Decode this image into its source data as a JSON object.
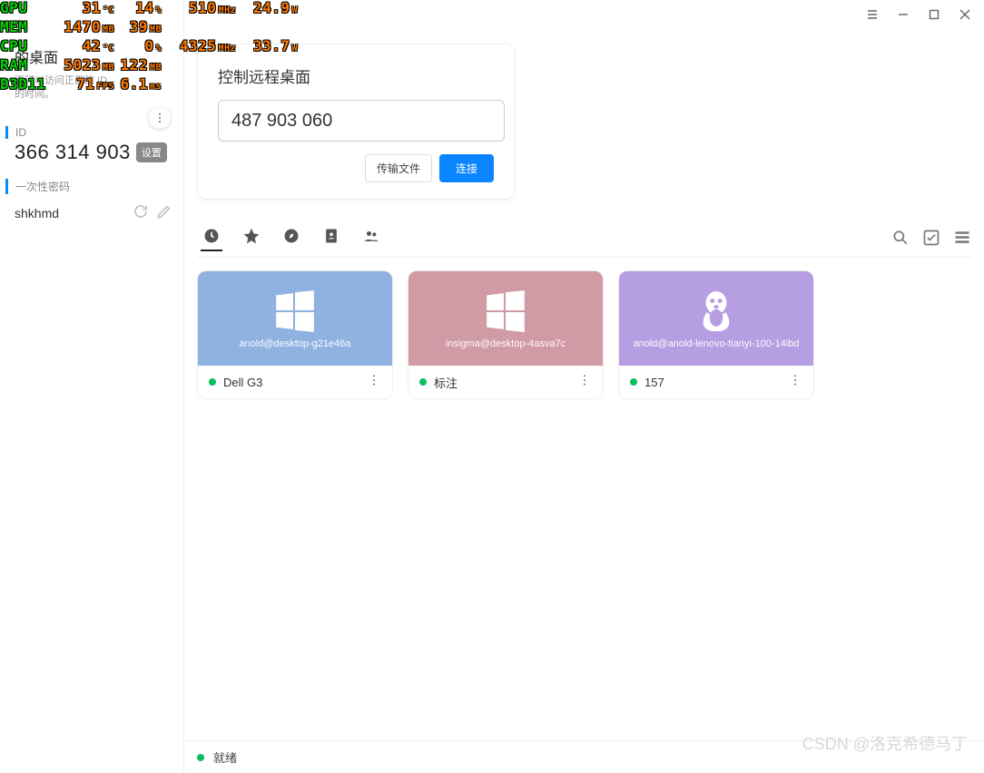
{
  "overlay": {
    "rows": [
      "GPU",
      "MEM",
      "CPU",
      "RAM",
      "D3D11"
    ],
    "gpu": {
      "temp": "31",
      "temp_u": "°C",
      "load": "14",
      "load_u": "%",
      "clk": "510",
      "clk_u": "MHz",
      "pw": "24.9",
      "pw_u": "W"
    },
    "mem": {
      "v1": "1470",
      "v1_u": "MB",
      "v2": "39",
      "v2_u": "MB"
    },
    "cpu": {
      "temp": "42",
      "temp_u": "°C",
      "load": "0",
      "load_u": "%",
      "clk": "4325",
      "clk_u": "MHz",
      "pw": "33.7",
      "pw_u": "W"
    },
    "ram": {
      "v1": "5023",
      "v1_u": "MB",
      "v2": "122",
      "v2_u": "MB"
    },
    "d3d": {
      "v1": "71",
      "v1_u": "FPS",
      "v2": "6.1",
      "v2_u": "ms"
    }
  },
  "sidebar": {
    "title": "的桌面",
    "sub": "面可以访问正面的 ID",
    "sub2": "的时间。",
    "id_label": "ID",
    "id_value": "366 314 903",
    "id_set": "设置",
    "pw_label": "一次性密码",
    "pw_value": "shkhmd"
  },
  "control": {
    "title": "控制远程桌面",
    "input": "487 903 060",
    "btn_file": "传输文件",
    "btn_conn": "连接"
  },
  "cards": [
    {
      "host": "anold@desktop-g21e46a",
      "name": "Dell G3",
      "os": "win"
    },
    {
      "host": "insigma@desktop-4asva7c",
      "name": "标注",
      "os": "win"
    },
    {
      "host": "anold@anold-lenovo-tianyi-100-14ibd",
      "name": "157",
      "os": "linux"
    }
  ],
  "status": {
    "text": "就绪"
  },
  "watermark": "CSDN @洛克希德马丁"
}
